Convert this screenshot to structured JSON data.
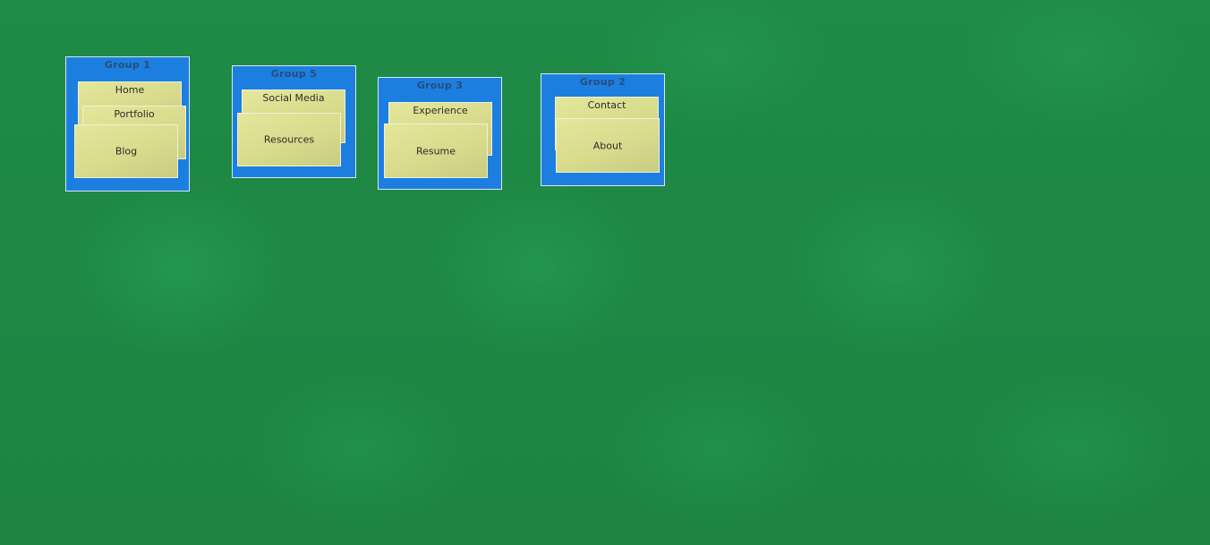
{
  "groups": [
    {
      "title": "Group 1",
      "cards": [
        "Home",
        "Portfolio",
        "Blog"
      ]
    },
    {
      "title": "Group 5",
      "cards": [
        "Social Media",
        "Resources"
      ]
    },
    {
      "title": "Group 3",
      "cards": [
        "Experience",
        "Resume"
      ]
    },
    {
      "title": "Group 2",
      "cards": [
        "Contact",
        "About"
      ]
    }
  ],
  "colors": {
    "background": "#1f8a45",
    "group": "#1c7fe0",
    "card": "#dcdf90"
  }
}
